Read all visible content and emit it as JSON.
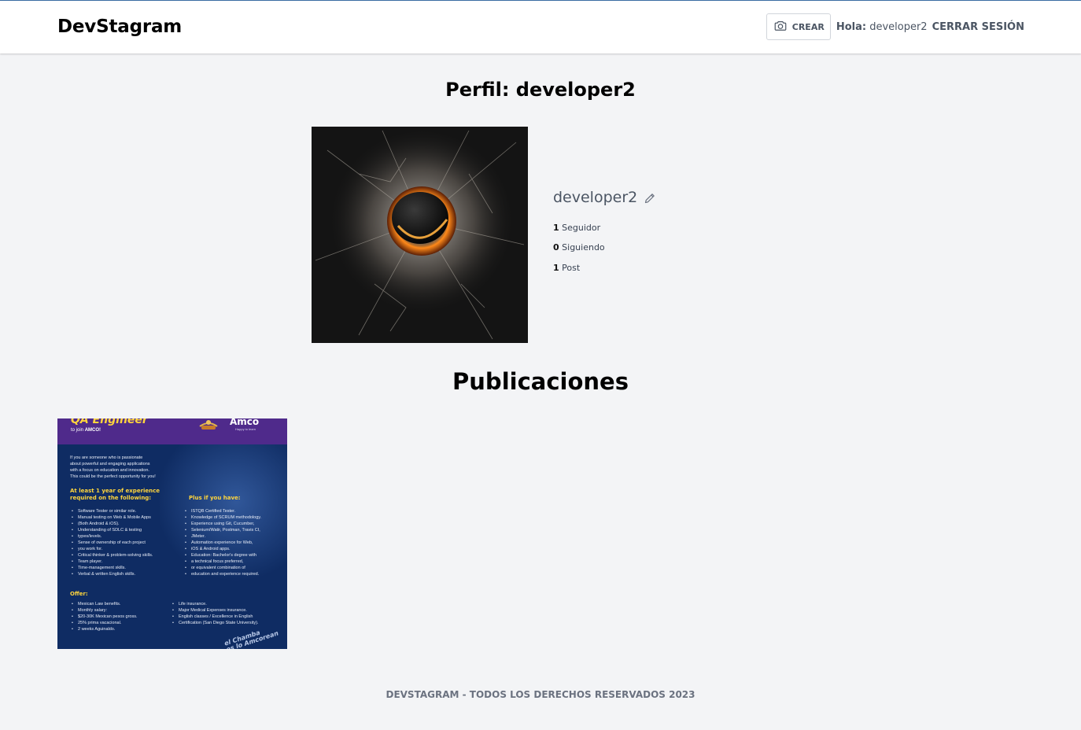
{
  "header": {
    "logo": "DevStagram",
    "create_label": "CREAR",
    "greeting_label": "Hola:",
    "greeting_user": "developer2",
    "logout_label": "CERRAR SESIÓN"
  },
  "profile": {
    "title": "Perfil: developer2",
    "username": "developer2",
    "followers_count": "1",
    "followers_label": "Seguidor",
    "following_count": "0",
    "following_label": "Siguiendo",
    "posts_count": "1",
    "posts_label": "Post"
  },
  "posts_section": {
    "title": "Publicaciones",
    "posts": [
      {
        "image": {
          "headline": "QA Engineer",
          "join_prefix": "to join",
          "join_company": "AMCO!",
          "company": "Amco",
          "company_tagline": "Happy to learn",
          "intro": [
            "If you are someone who is passionate",
            "about powerful and engaging applications",
            "with a focus on education and innovation.",
            "This could be the perfect opportunity for you!"
          ],
          "req_heading_1": "At least 1 year of experience",
          "req_heading_2": "required on the following:",
          "requirements": [
            "Software Tester or similar role.",
            "Manual testing on Web & Mobile Apps",
            "(Both Android & iOS).",
            "Understanding of SDLC & testing",
            "types/levels.",
            "Sense of ownership of each project",
            "you work for.",
            "Critical thinker & problem-solving skills.",
            "Team player.",
            "Time-management skills.",
            "Verbal & written English skills."
          ],
          "plus_heading": "Plus if you have:",
          "plus": [
            "ISTQB Certified Tester.",
            "Knowledge of SCRUM methodology.",
            "Experience using Git, Cucumber,",
            "Selenium/Watir, Postman, Travis CI,",
            "JMeter.",
            "Automation experience for Web,",
            "iOS & Android apps.",
            "Education: Bachelor's degree with",
            "a technical focus preferred,",
            "or equivalent combination of",
            "education and experience required."
          ],
          "offer_heading": "Offer:",
          "offer_left": [
            "Mexican Law benefits.",
            "Monthly salary:",
            "$20-30K Mexican pesos gross.",
            "25% prima vacacional.",
            "2 weeks Aguinaldo."
          ],
          "offer_right": [
            "Life insurance.",
            "Major Medical Expenses insurance.",
            "English classes / Excellence in English",
            "Certification (San Diego State University)."
          ],
          "stamp_1": "el Chamba",
          "stamp_2": "es lo Amcorean"
        }
      }
    ]
  },
  "footer": {
    "text": "DEVSTAGRAM - TODOS LOS DERECHOS RESERVADOS 2023"
  },
  "colors": {
    "page_background": "#f3f4f6",
    "header_background": "#ffffff",
    "muted_text": "#4b5563",
    "footer_text": "#6b7280",
    "post_navy": "#0f2c63",
    "post_purple": "#4f2a8b",
    "post_yellow": "#ffd53d"
  },
  "icons": {
    "create": "camera-icon",
    "edit_profile": "pencil-icon"
  }
}
